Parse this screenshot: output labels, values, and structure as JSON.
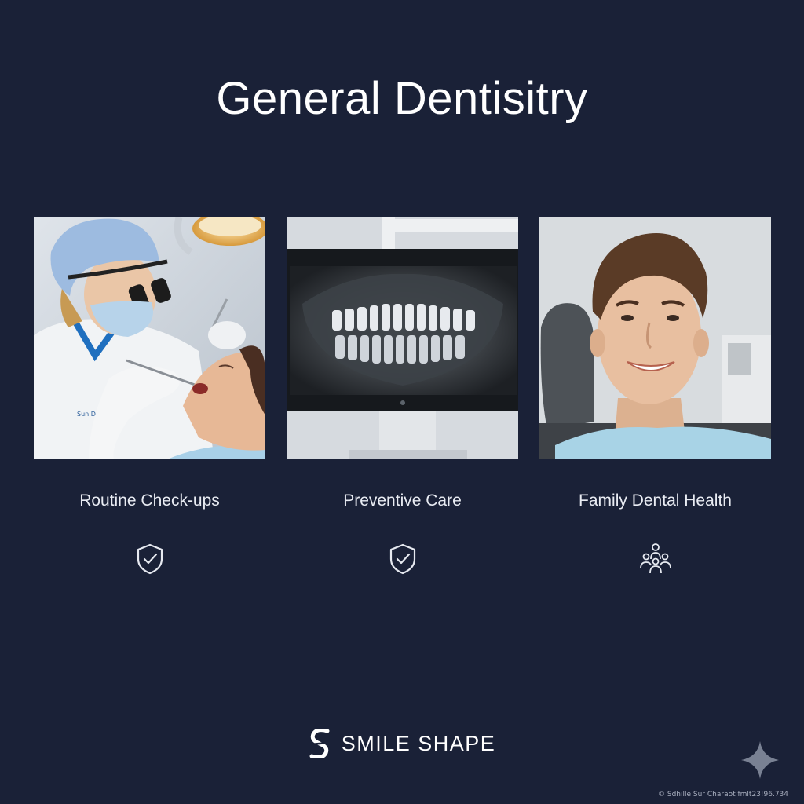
{
  "page": {
    "title": "General Dentisitry"
  },
  "cards": [
    {
      "label": "Routine Check-ups",
      "image": "dentist-examining-patient",
      "icon": "shield-check-icon"
    },
    {
      "label": "Preventive Care",
      "image": "panoramic-dental-xray-monitor",
      "icon": "shield-check-icon"
    },
    {
      "label": "Family Dental Health",
      "image": "smiling-patient-in-dental-chair",
      "icon": "family-group-icon"
    }
  ],
  "brand": {
    "name": "SMILE SHAPE",
    "logo": "s-logo-icon"
  },
  "watermark": "© Sdhille Sur Charaot fmlt23!96.734",
  "colors": {
    "background": "#1a2137",
    "text": "#ffffff",
    "label": "#e9ecf3",
    "icon_stroke": "#e6e9f0"
  }
}
